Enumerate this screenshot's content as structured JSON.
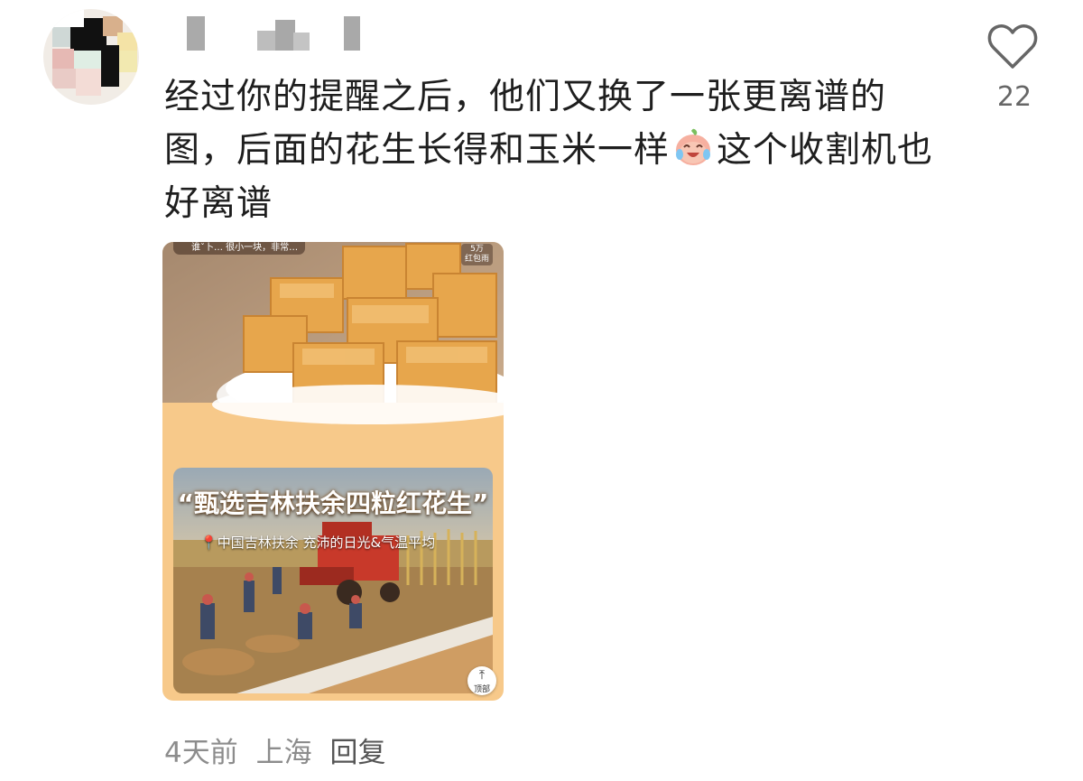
{
  "comment": {
    "text_part1": "经过你的提醒之后，他们又换了一张更离谱的图，后面的花生长得和玉米一样",
    "emoji": "crying-laughing-emoji",
    "text_part2": "这个收割机也好离谱"
  },
  "like": {
    "icon": "heart-outline-icon",
    "count": "22"
  },
  "attachment": {
    "top_chip": "谁ˇ卜… 很小一块，非常…",
    "red_chip_line1": "5万",
    "red_chip_line2": "红包雨",
    "banner": "“甄选吉林扶余四粒红花生”",
    "location": "中国吉林扶余 充沛的日光&气温平均",
    "top_button": "顶部"
  },
  "footer": {
    "time": "4天前",
    "location": "上海",
    "reply": "回复"
  },
  "colors": {
    "accent_bg": "#f7c98a",
    "meta": "#8c8c8c"
  }
}
